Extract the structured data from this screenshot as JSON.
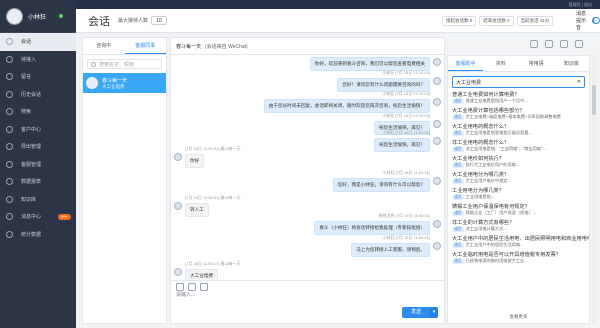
{
  "topbar": {
    "text": "管理员 | 退出"
  },
  "user": {
    "name": "小林狂"
  },
  "nav": [
    {
      "label": "会话",
      "icon": "chat-icon",
      "active": true
    },
    {
      "label": "待接入",
      "icon": "queue-icon"
    },
    {
      "label": "留言",
      "icon": "message-icon"
    },
    {
      "label": "历史会话",
      "icon": "history-icon"
    },
    {
      "label": "搜索",
      "icon": "search-icon"
    },
    {
      "label": "客户中心",
      "icon": "customer-icon"
    },
    {
      "label": "productivity",
      "icon": "chart-icon",
      "text": "导出管理"
    },
    {
      "label": "客服管理",
      "icon": "agent-icon"
    },
    {
      "label": "数据报表",
      "icon": "report-icon"
    },
    {
      "label": "知识库",
      "icon": "book-icon"
    },
    {
      "label": "消息中心",
      "icon": "bell-icon",
      "badge": "99+"
    },
    {
      "label": "统计数据",
      "icon": "stats-icon"
    }
  ],
  "header": {
    "title": "会话",
    "max_label": "最大接待人数",
    "max_value": "10",
    "stats": [
      "接起会话数 0",
      "结束会话数 0",
      "当前会话 41分"
    ],
    "notice_label": "消息提示音"
  },
  "contacts": {
    "tabs": [
      "咨询中",
      "客服同事"
    ],
    "search_placeholder": "搜索名字、昵称",
    "items": [
      {
        "name": "春斗每一天",
        "sub": "大工业电费"
      }
    ]
  },
  "chat": {
    "title": "春斗每一天",
    "source": "(会话来自 WeChat)",
    "input_placeholder": "请输入...",
    "send": "发送",
    "messages": [
      {
        "side": "right",
        "meta": "",
        "text": "你好，欢迎来到春斗咨询，我们可以帮您查看电费相关"
      },
      {
        "side": "right",
        "meta": "小林狂 [7月 18日 21:10:04]",
        "text": "您好！请问您有什么问题需要咨询的吗？"
      },
      {
        "side": "right",
        "meta": "小林狂 [7月 18日 21:10:04]",
        "text": "由于您长时间未回复，会话即将关闭，随时欢迎您再次咨询，祝您生活愉快！"
      },
      {
        "side": "right",
        "meta": "小林狂 [7月 18日 21:10:04]",
        "text": "祝您生活愉快，再见！"
      },
      {
        "side": "right",
        "meta": "小林狂 [7月 18日 11:54:31]",
        "text": "祝您生活愉快，再见！"
      },
      {
        "side": "left",
        "meta": "[7月 18日 11:54:31] 春斗每一天",
        "text": "你好"
      },
      {
        "side": "right",
        "meta": "小林狂 [7月 18日 11:54:31]",
        "text": "您好，我是小林狂，请问有什么可以帮您？"
      },
      {
        "side": "left",
        "meta": "[7月 18日 11:54:31] 春斗每一天",
        "text": "转人工"
      },
      {
        "side": "right",
        "meta": "系统消息 [7月 18日 11:54:31]",
        "text": "春斗（小林狂）将会话转接给我处理（专家技能组）"
      },
      {
        "side": "right",
        "meta": "小林狂 [7月 18日 11:54:31]",
        "text": "马上为您转接人工客服，请稍后。"
      },
      {
        "side": "left",
        "meta": "[7月 18日 11:55:17] 春斗每一天",
        "text": "大工业电费"
      }
    ]
  },
  "assistant": {
    "tabs": [
      "客服助手",
      "资料",
      "常用语",
      "知识库"
    ],
    "search_value": "大工业电费",
    "more": "查看更多",
    "items": [
      {
        "q": "普通工业电费如何计算电费？",
        "tags": [
          "通用"
        ],
        "a": "普通工业电费是指用户一个月中..."
      },
      {
        "q": "大工业电费计算包括哪些部分？",
        "tags": [
          "通用"
        ],
        "a": "大工业电费=电度电费+基本电费+功率因数调整电费"
      },
      {
        "q": "大工业用电的概念什么？",
        "tags": [
          "通用"
        ],
        "a": "大工业用电是指受电变压器总容量..."
      },
      {
        "q": "非工业用电的概念什么？",
        "tags": [
          "通用"
        ],
        "a": "非工业用电是指：“工业用电”、“商业用电”..."
      },
      {
        "q": "大工业电价如何执行？",
        "tags": [
          "通用"
        ],
        "a": "执行大工业电价用户的用电..."
      },
      {
        "q": "大工业用电分为哪几类？",
        "tags": [
          "通用"
        ],
        "a": "大工业用户电价中规定..."
      },
      {
        "q": "工业用电分为哪几类？",
        "tags": [
          "通用"
        ],
        "a": "工业用电是指..."
      },
      {
        "q": "铸锻工业用户保温保电有何规定？",
        "tags": [
          "通用"
        ],
        "a": "铸锻企业（工厂）用户保温（保电）..."
      },
      {
        "q": "非工业的计算方式有哪些？",
        "tags": [
          "通用"
        ],
        "a": "非工业用电计算方式..."
      },
      {
        "q": "大工业用户中的居民生活用电、出居民照明用电和商业用电电价如何计算？",
        "tags": [
          "通用"
        ],
        "a": "大工业用户中的居民生活用电..."
      },
      {
        "q": "大工业临时用电是否可以开具增值税专用发票？",
        "tags": [
          "通用"
        ],
        "a": "已经装电表的临时用电按大工业..."
      }
    ]
  }
}
